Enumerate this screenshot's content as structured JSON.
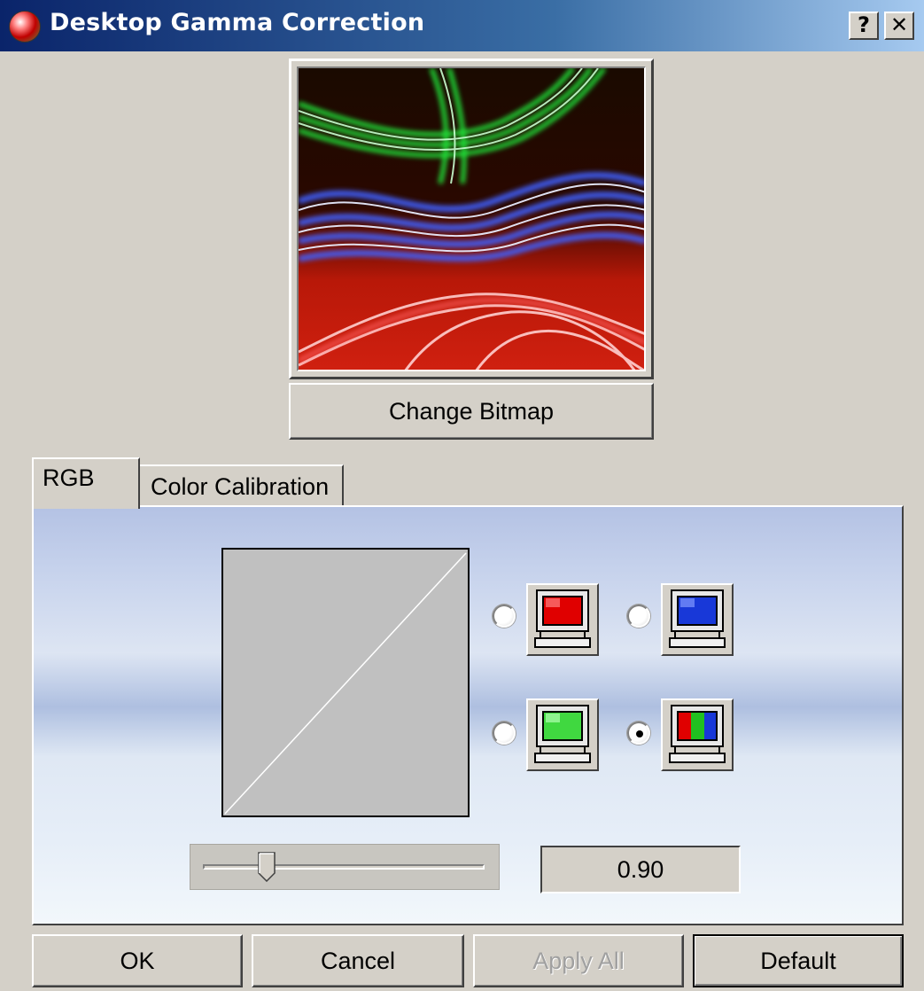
{
  "window": {
    "title": "Desktop Gamma Correction",
    "help_label": "?",
    "close_label": "✕"
  },
  "preview": {
    "change_bitmap_label": "Change Bitmap"
  },
  "tabs": [
    {
      "label": "RGB",
      "active": true
    },
    {
      "label": "Color Calibration",
      "active": false
    }
  ],
  "channels": [
    {
      "name": "red",
      "color": "#e00000",
      "selected": false
    },
    {
      "name": "blue",
      "color": "#1838d8",
      "selected": false
    },
    {
      "name": "green",
      "color": "#20c820",
      "selected": false
    },
    {
      "name": "all",
      "color": "multi",
      "selected": true
    }
  ],
  "gamma": {
    "value_text": "0.90",
    "slider_fraction": 0.2
  },
  "buttons": {
    "ok": "OK",
    "cancel": "Cancel",
    "apply_all": "Apply All",
    "default": "Default"
  },
  "colors": {
    "title_start": "#0a246a",
    "title_end": "#a6caf0",
    "face": "#d4d0c8"
  }
}
